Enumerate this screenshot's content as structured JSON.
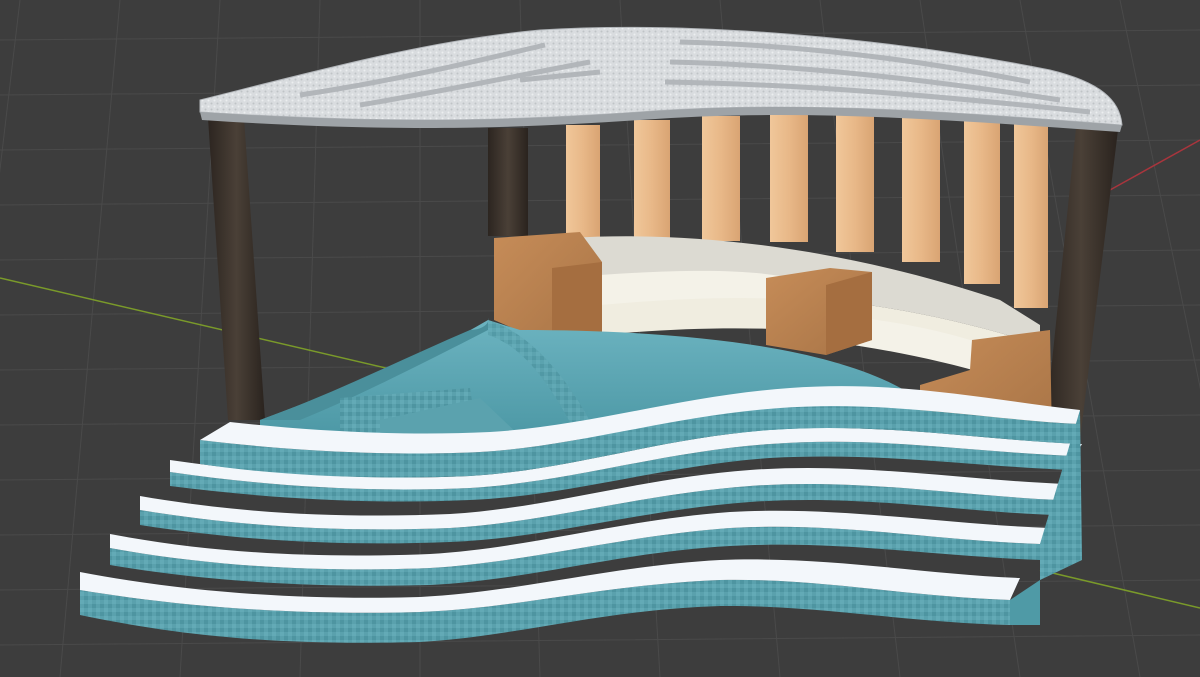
{
  "viewport": {
    "kind": "3d-viewport",
    "background": "#3d3d3d",
    "grid_color": "#4a4a4a",
    "axis_x_color": "#a8353d",
    "axis_y_color": "#7a9a2a"
  },
  "model": {
    "canopy_color": "#d7d9dc",
    "post_color": "#3e362f",
    "slat_color": "#e6b98c",
    "bench_wood_color": "#b8804f",
    "cushion_color": "#ece8d8",
    "pool_color": "#5ea7b5",
    "tile_color": "#4f9aa6",
    "step_color": "#f3f7fb"
  }
}
